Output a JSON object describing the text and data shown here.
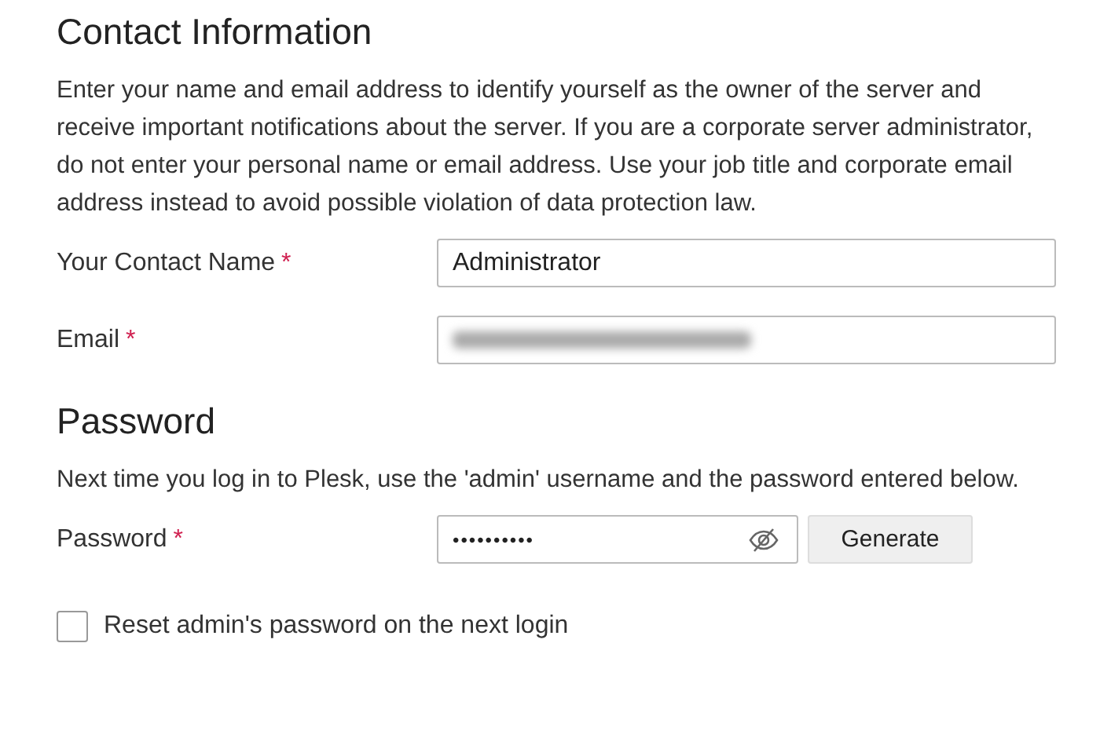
{
  "sections": [
    {
      "title": "Contact Information",
      "description": "Enter your name and email address to identify yourself as the owner of the server and receive important notifications about the server. If you are a corporate server administrator, do not enter your personal name or email address. Use your job title and corporate email address instead to avoid possible violation of data protection law.",
      "fields": [
        {
          "kind": "text",
          "label": "Your Contact Name",
          "required_mark": "*",
          "value": "Administrator"
        },
        {
          "kind": "redacted",
          "label": "Email",
          "required_mark": "*"
        }
      ]
    },
    {
      "title": "Password",
      "description": "Next time you log in to Plesk, use the 'admin' username and the password entered below.",
      "fields": [
        {
          "kind": "password",
          "label": "Password",
          "required_mark": "*",
          "value": "••••••••••",
          "button": "Generate"
        },
        {
          "kind": "checkbox",
          "label": "Reset admin's password on the next login",
          "checked": false
        }
      ]
    }
  ]
}
